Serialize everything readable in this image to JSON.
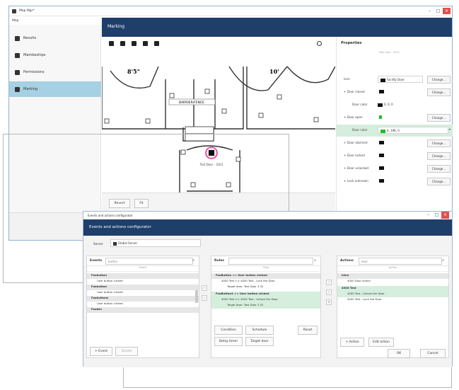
{
  "main_window": {
    "title": "Map Mgr*",
    "menu": "Map",
    "nav": [
      {
        "label": "Results",
        "icon": "wrench-icon"
      },
      {
        "label": "Mambeships",
        "icon": "layers-icon"
      },
      {
        "label": "Permissions",
        "icon": "people-icon"
      },
      {
        "label": "Marking",
        "icon": "marker-icon"
      }
    ],
    "active_nav": "Marking",
    "header": "Marking",
    "floorplan": {
      "room_left": "8'5\"",
      "room_right": "10'",
      "center_label": "BARRIER/FENCE",
      "door_label": "Test Door · 3101"
    },
    "buttons": {
      "revert": "Revert",
      "fit": "Fit"
    }
  },
  "properties": {
    "title": "Properties",
    "column_hint": "Map-Sign · 4001",
    "rows": [
      {
        "label": "Icon",
        "value": "Facility Door",
        "change": "Change..."
      },
      {
        "label": "+ Door closed",
        "value": "",
        "change": "Change..."
      },
      {
        "label": "Door color",
        "value": "0, 0, 0",
        "swatch": "#111111",
        "change": ""
      },
      {
        "label": "+ Door open",
        "value": "",
        "change": "Change..."
      },
      {
        "label": "Door color",
        "value": "0, 196, 0",
        "swatch": "#1fbf2a",
        "change": ""
      },
      {
        "label": "+ Door alarmed",
        "value": "",
        "change": "Change..."
      },
      {
        "label": "+ Door locked",
        "value": "",
        "change": "Change..."
      },
      {
        "label": "+ Door unlocked",
        "value": "",
        "change": "Change..."
      },
      {
        "label": "+ Lock unknown",
        "value": "",
        "change": "Change..."
      }
    ]
  },
  "dialog": {
    "title": "Events and actions configurator",
    "header": "Events and actions configurator",
    "server_label": "Server",
    "server_value": "Global Server",
    "events": {
      "title": "Events",
      "search": "button",
      "column": "Event",
      "rows": [
        {
          "text": "Foobutton",
          "kind": "group"
        },
        {
          "text": "User button clicked",
          "kind": "item"
        },
        {
          "text": "Foobutton",
          "kind": "group"
        },
        {
          "text": "User button clicked",
          "kind": "item"
        },
        {
          "text": "Foobuttons",
          "kind": "group"
        },
        {
          "text": "User button clicked",
          "kind": "item"
        },
        {
          "text": "Foobtn",
          "kind": "group"
        }
      ],
      "add": "Event",
      "delete": "Delete"
    },
    "rules": {
      "title": "Rules",
      "column": "Rule",
      "rows": [
        {
          "text": "FooButton >> User button clicked",
          "kind": "group"
        },
        {
          "text": "4000 Test >> 4000 Test - Lock the Door",
          "kind": "item"
        },
        {
          "text": "Target door: Test Door 3.32",
          "kind": "item"
        },
        {
          "text": "FooButton2 >> User button clicked",
          "kind": "grouphl"
        },
        {
          "text": "4000 Test >> 4000 Test - Unlock the Door",
          "kind": "hl"
        },
        {
          "text": "Target door: Test Door 3.32",
          "kind": "hl"
        }
      ],
      "condition": "Condition",
      "schedule": "Schedule",
      "reset": "Reset",
      "delay": "Delay timer",
      "target": "Target door"
    },
    "actions": {
      "title": "Actions",
      "search": "door",
      "column": "Action",
      "rows": [
        {
          "text": "Intro",
          "kind": "group"
        },
        {
          "text": "4000 Door action",
          "kind": "item"
        },
        {
          "text": "4000 Test",
          "kind": "grouphl"
        },
        {
          "text": "4000 Test - Unlock the Door",
          "kind": "hl"
        },
        {
          "text": "4000 Test - Lock the Door",
          "kind": "item"
        }
      ],
      "add": "Action",
      "edit": "Edit action"
    },
    "ok": "OK",
    "cancel": "Cancel"
  },
  "colors": {
    "header_blue": "#1f3f6b",
    "nav_active": "#a6d0e4",
    "highlight_green": "#d6eedd",
    "door_ring": "#e23d8e",
    "close_red": "#e0504a"
  }
}
